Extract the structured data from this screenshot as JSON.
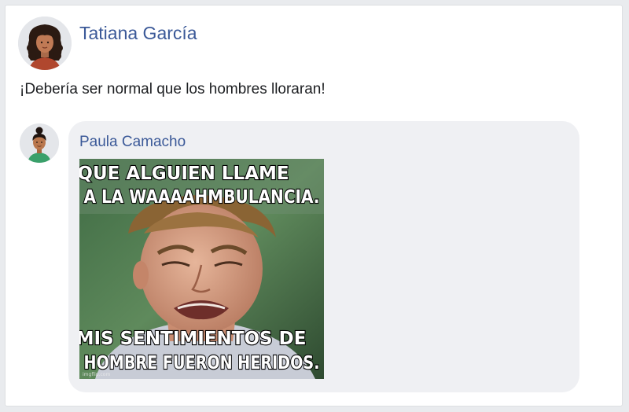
{
  "post": {
    "author_name": "Tatiana García",
    "author_avatar_icon": "avatar-woman-curly-hair-icon",
    "text": "¡Debería ser normal que los hombres lloraran!"
  },
  "comment": {
    "author_name": "Paula Camacho",
    "author_avatar_icon": "avatar-woman-bun-icon",
    "meme": {
      "top_line_1": "QUE ALGUIEN LLAME",
      "top_line_2": "A LA WAAAAHMBULANCIA.",
      "bottom_line_1": "MIS SENTIMIENTOS DE",
      "bottom_line_2": "HOMBRE FUERON HERIDOS.",
      "watermark": "imgflip.com"
    }
  },
  "colors": {
    "link_blue": "#3b5998",
    "bubble_gray": "#eff0f3",
    "page_background": "#e9ebee"
  }
}
